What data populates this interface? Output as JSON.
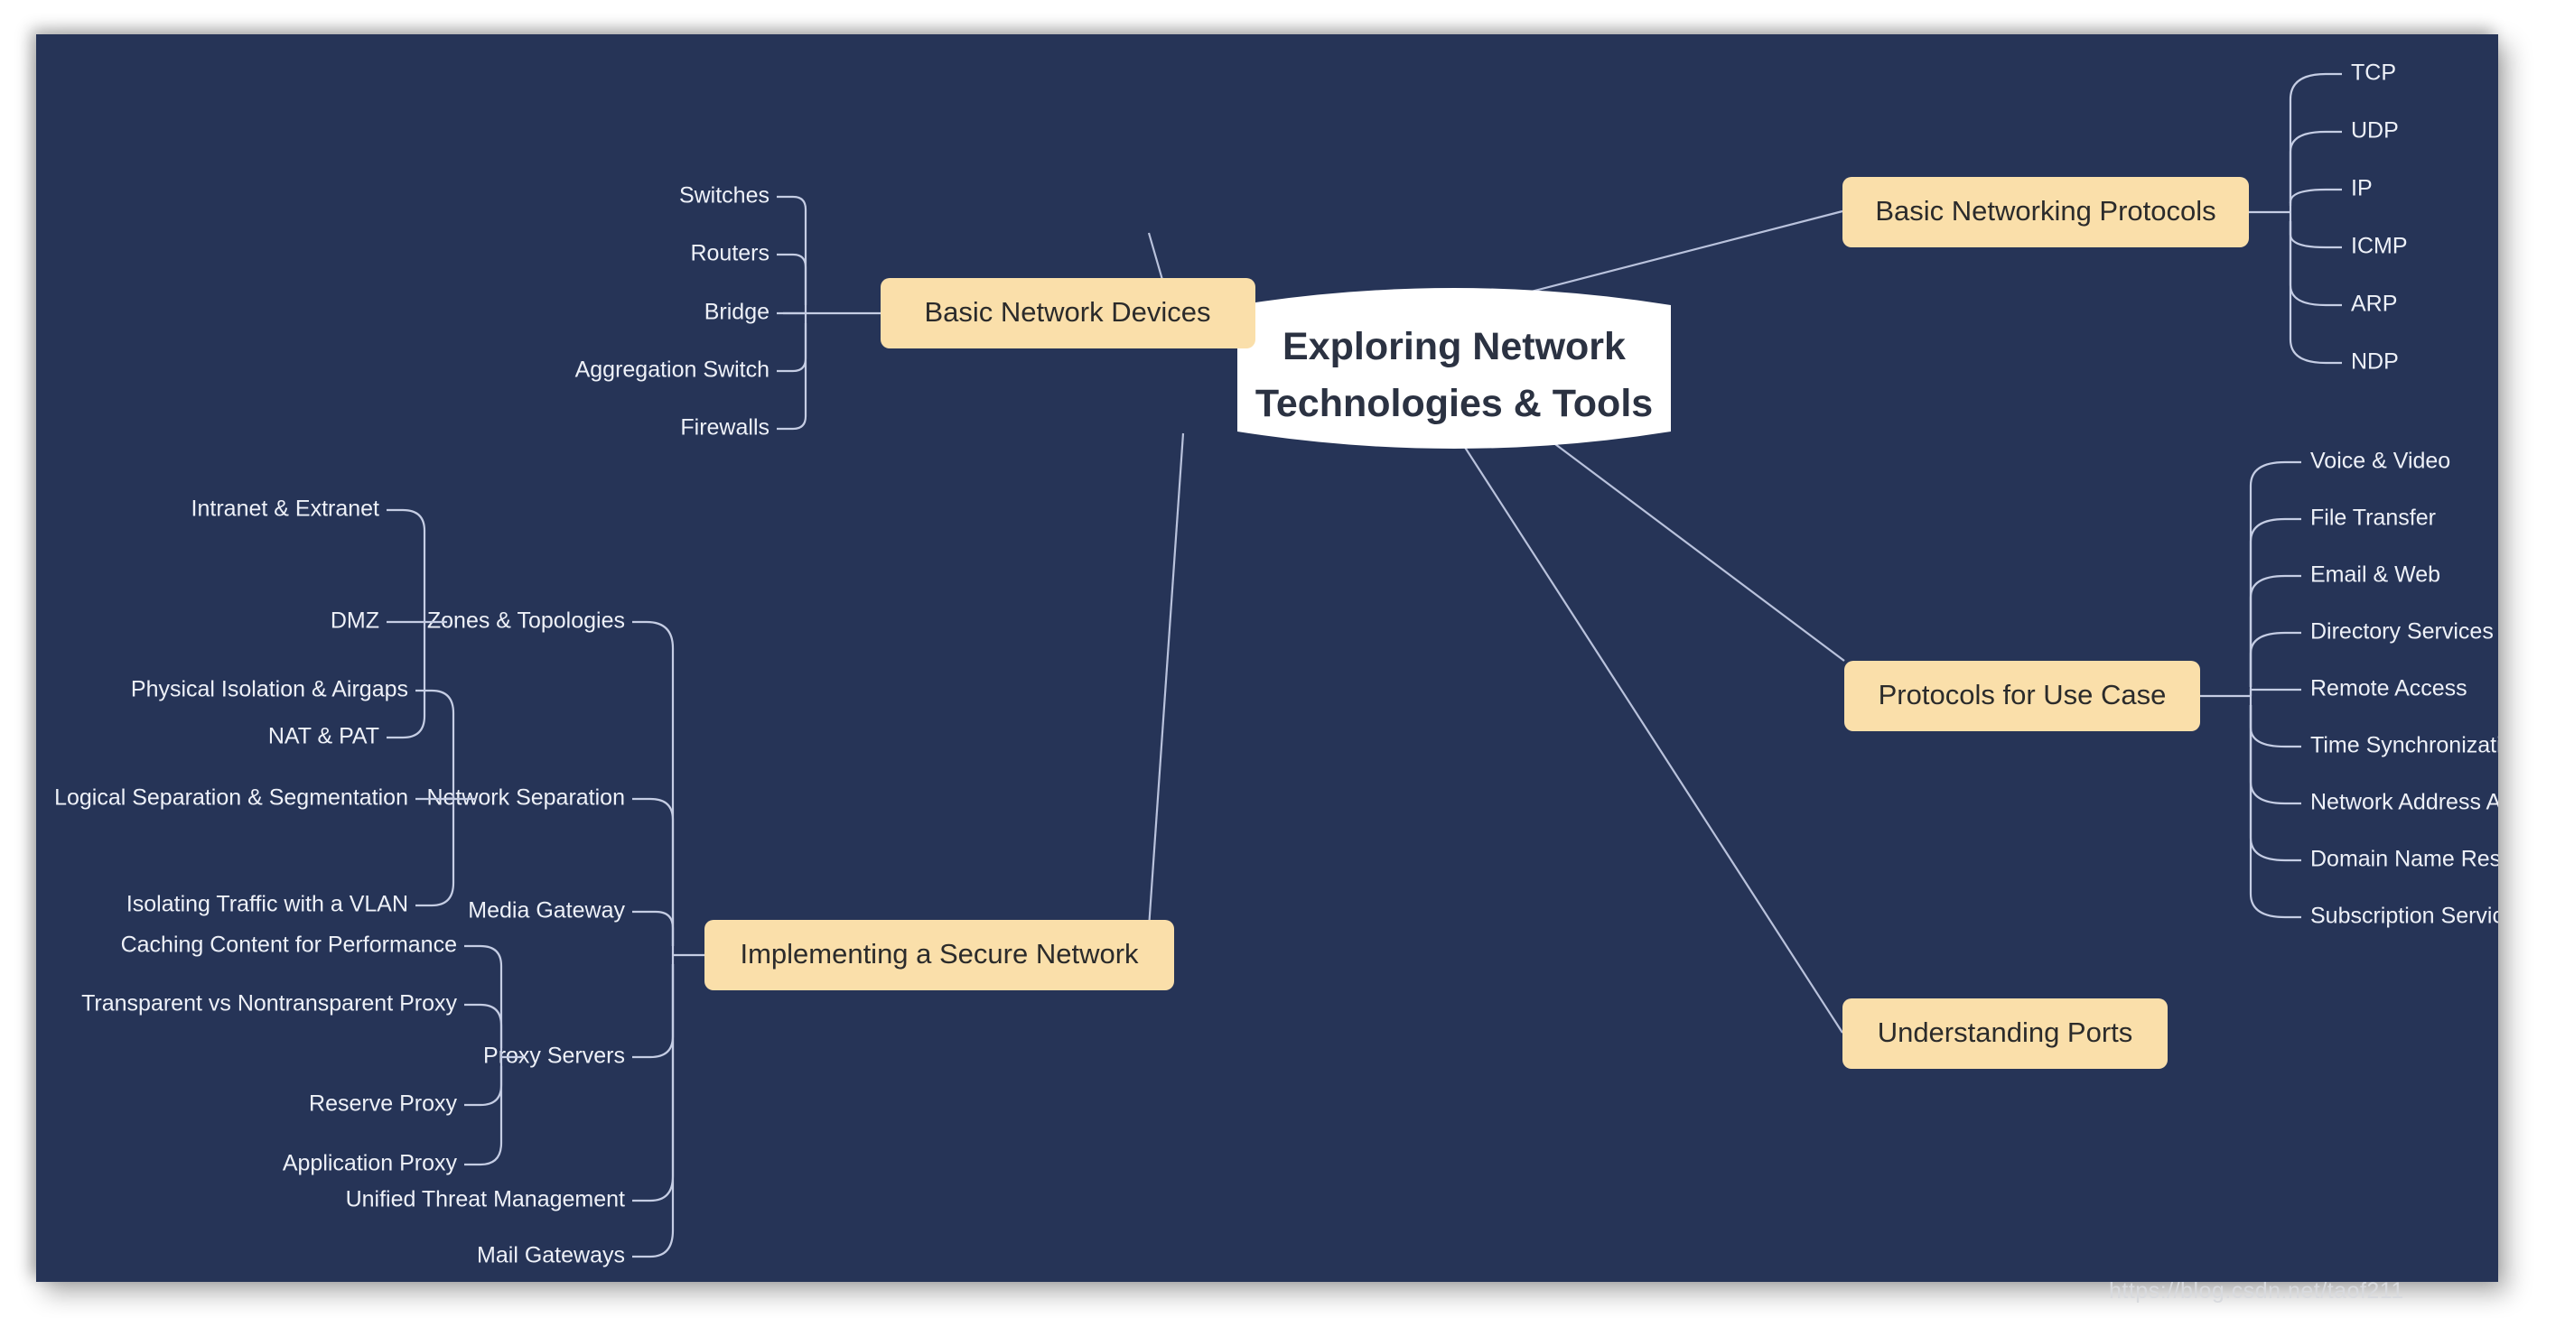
{
  "colors": {
    "canvas_background": "#263457",
    "branch_box": "#fadfaa",
    "branch_text": "#2b2b2b",
    "root_background": "#ffffff",
    "root_text": "#2b3242",
    "leaf_text": "#eef1f8",
    "connector": "#c5cde4"
  },
  "root": {
    "line1": "Exploring Network",
    "line2": "Technologies & Tools"
  },
  "watermark": "https://blog.csdn.net/taof211",
  "branches": {
    "basic_network_devices": {
      "label": "Basic Network Devices",
      "children": [
        {
          "label": "Switches"
        },
        {
          "label": "Routers"
        },
        {
          "label": "Bridge"
        },
        {
          "label": "Aggregation Switch"
        },
        {
          "label": "Firewalls"
        }
      ]
    },
    "basic_networking_protocols": {
      "label": "Basic Networking Protocols",
      "children": [
        {
          "label": "TCP"
        },
        {
          "label": "UDP"
        },
        {
          "label": "IP"
        },
        {
          "label": "ICMP"
        },
        {
          "label": "ARP"
        },
        {
          "label": "NDP"
        }
      ]
    },
    "protocols_for_use_case": {
      "label": "Protocols for Use Case",
      "children": [
        {
          "label": "Voice & Video"
        },
        {
          "label": "File Transfer"
        },
        {
          "label": "Email & Web"
        },
        {
          "label": "Directory Services"
        },
        {
          "label": "Remote Access"
        },
        {
          "label": "Time Synchronization"
        },
        {
          "label": "Network Address Allocation"
        },
        {
          "label": "Domain Name Resolution"
        },
        {
          "label": "Subscription Services"
        }
      ]
    },
    "understanding_ports": {
      "label": "Understanding Ports",
      "children": []
    },
    "implementing_a_secure_network": {
      "label": "Implementing a Secure Network",
      "children": [
        {
          "label": "Zones & Topologies",
          "children": [
            {
              "label": "Intranet & Extranet"
            },
            {
              "label": "DMZ"
            },
            {
              "label": "NAT & PAT"
            }
          ]
        },
        {
          "label": "Network Separation",
          "children": [
            {
              "label": "Physical Isolation & Airgaps"
            },
            {
              "label": "Logical Separation & Segmentation"
            },
            {
              "label": "Isolating Traffic with a VLAN"
            }
          ]
        },
        {
          "label": "Media Gateway",
          "children": []
        },
        {
          "label": "Proxy Servers",
          "children": [
            {
              "label": "Caching Content for Performance"
            },
            {
              "label": "Transparent vs Nontransparent Proxy"
            },
            {
              "label": "Reserve Proxy"
            },
            {
              "label": "Application Proxy"
            }
          ]
        },
        {
          "label": "Unified Threat Management",
          "children": []
        },
        {
          "label": "Mail Gateways",
          "children": []
        }
      ]
    }
  }
}
